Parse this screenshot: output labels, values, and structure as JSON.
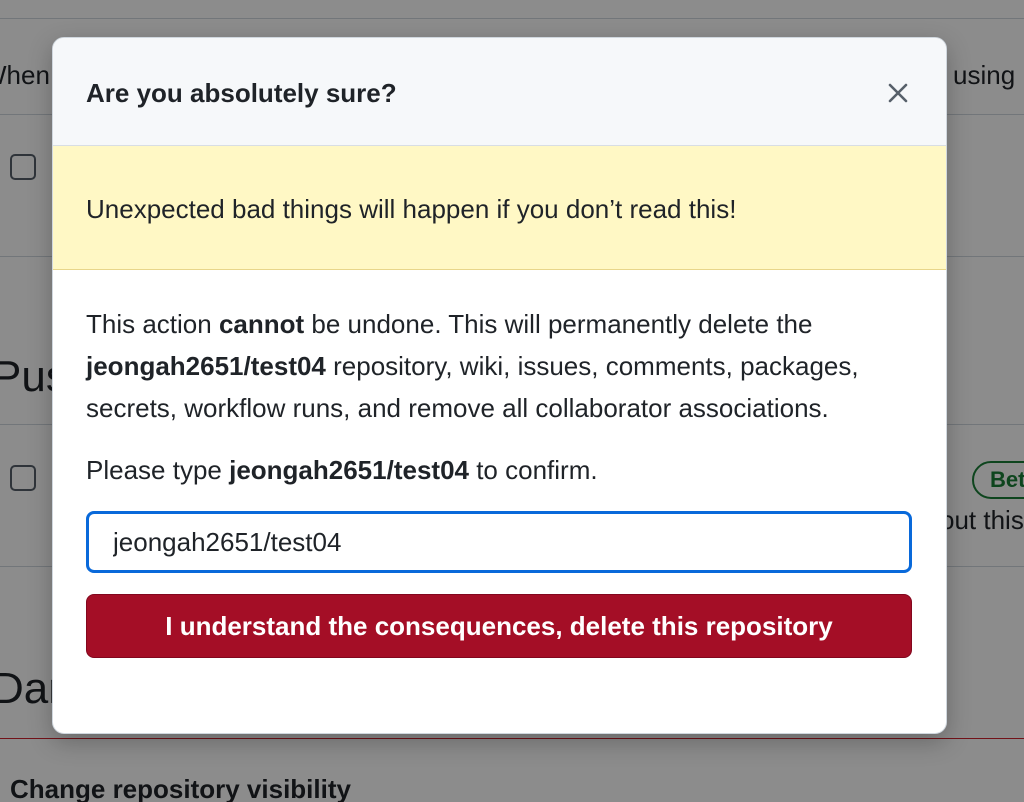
{
  "background": {
    "fragment_left_top": "When",
    "fragment_right_top": "l using",
    "heading_push": "Pus",
    "heading_danger": "Dan",
    "badge": "Bet",
    "fragment_right_mid": "out this",
    "section_title": "Change repository visibility"
  },
  "modal": {
    "title": "Are you absolutely sure?",
    "close_icon": "close-icon",
    "warning": "Unexpected bad things will happen if you don’t read this!",
    "description": {
      "part1": "This action ",
      "strong1": "cannot",
      "part2": " be undone. This will permanently delete the ",
      "repo": "jeongah2651/test04",
      "part3": " repository, wiki, issues, comments, packages, secrets, workflow runs, and remove all collaborator associations."
    },
    "confirm": {
      "prefix": "Please type ",
      "repo": "jeongah2651/test04",
      "suffix": " to confirm."
    },
    "input_value": "jeongah2651/test04",
    "delete_button": "I understand the consequences, delete this repository"
  },
  "colors": {
    "warning_bg": "#fff8c5",
    "danger_button": "#a40e26",
    "focus_border": "#0969da"
  }
}
